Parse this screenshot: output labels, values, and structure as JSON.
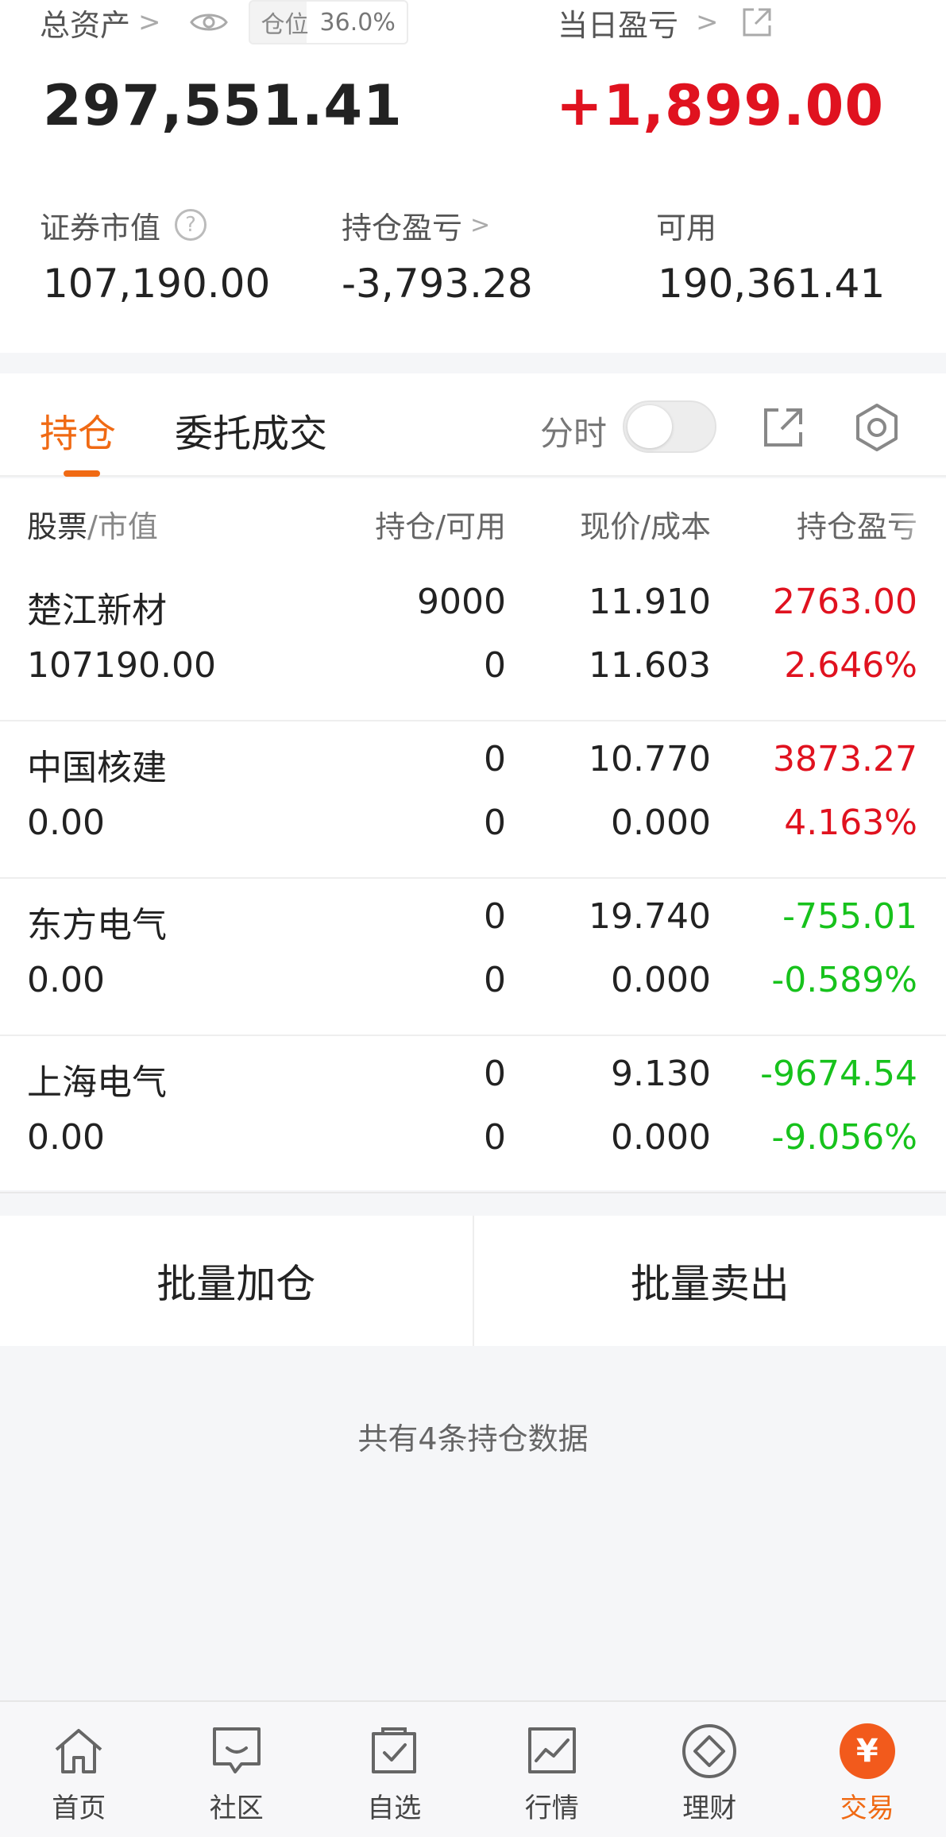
{
  "summary": {
    "total_assets_label": "总资产",
    "position_label": "仓位",
    "position_value": "36.0%",
    "position_fraction": 0.36,
    "total_assets_value": "297,551.41",
    "daily_pnl_label": "当日盈亏",
    "daily_pnl_value": "+1,899.00",
    "securities_value_label": "证券市值",
    "securities_value": "107,190.00",
    "holding_pnl_label": "持仓盈亏",
    "holding_pnl_value": "-3,793.28",
    "available_label": "可用",
    "available_value": "190,361.41"
  },
  "tabs": {
    "holdings": "持仓",
    "orders": "委托成交",
    "intraday_label": "分时",
    "intraday_on": false
  },
  "table": {
    "headers": {
      "stock": "股票",
      "market_value": "/市值",
      "holding_available": "持仓/可用",
      "price_cost": "现价/成本",
      "pnl": "持仓盈亏"
    },
    "rows": [
      {
        "name": "楚江新材",
        "market_value": "107190.00",
        "holding": "9000",
        "available": "0",
        "price": "11.910",
        "cost": "11.603",
        "pnl": "2763.00",
        "pnl_pct": "2.646%",
        "trend": "up"
      },
      {
        "name": "中国核建",
        "market_value": "0.00",
        "holding": "0",
        "available": "0",
        "price": "10.770",
        "cost": "0.000",
        "pnl": "3873.27",
        "pnl_pct": "4.163%",
        "trend": "up"
      },
      {
        "name": "东方电气",
        "market_value": "0.00",
        "holding": "0",
        "available": "0",
        "price": "19.740",
        "cost": "0.000",
        "pnl": "-755.01",
        "pnl_pct": "-0.589%",
        "trend": "down"
      },
      {
        "name": "上海电气",
        "market_value": "0.00",
        "holding": "0",
        "available": "0",
        "price": "9.130",
        "cost": "0.000",
        "pnl": "-9674.54",
        "pnl_pct": "-9.056%",
        "trend": "down"
      }
    ]
  },
  "batch": {
    "add": "批量加仓",
    "sell": "批量卖出"
  },
  "footnote": "共有4条持仓数据",
  "nav": {
    "items": [
      {
        "label": "首页",
        "icon": "home-icon"
      },
      {
        "label": "社区",
        "icon": "chat-icon"
      },
      {
        "label": "自选",
        "icon": "watchlist-icon"
      },
      {
        "label": "行情",
        "icon": "market-chart-icon"
      },
      {
        "label": "理财",
        "icon": "diamond-icon"
      },
      {
        "label": "交易",
        "icon": "yen-icon",
        "active": true
      }
    ]
  },
  "colors": {
    "accent": "#f06a14",
    "profit": "#e0121f",
    "loss": "#17c21c"
  }
}
